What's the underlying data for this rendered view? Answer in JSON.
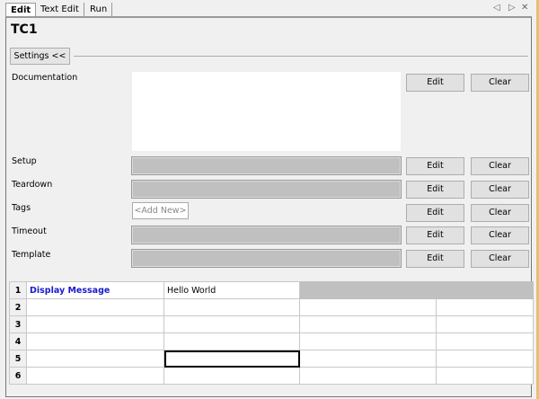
{
  "tabs": [
    {
      "label": "Edit",
      "active": true
    },
    {
      "label": "Text Edit"
    },
    {
      "label": "Run"
    }
  ],
  "nav": {
    "prev": "◁",
    "next": "▷",
    "close": "✕"
  },
  "title": "TC1",
  "settings_label": "Settings <<",
  "fields": {
    "documentation": "Documentation",
    "setup": "Setup",
    "teardown": "Teardown",
    "tags": "Tags",
    "timeout": "Timeout",
    "template": "Template"
  },
  "buttons": {
    "edit": "Edit",
    "clear": "Clear"
  },
  "tags_placeholder": "<Add New>",
  "grid": {
    "rows": [
      {
        "num": "1",
        "cells": [
          "Display Message",
          "Hello World",
          "",
          ""
        ]
      },
      {
        "num": "2",
        "cells": [
          "",
          "",
          "",
          ""
        ]
      },
      {
        "num": "3",
        "cells": [
          "",
          "",
          "",
          ""
        ]
      },
      {
        "num": "4",
        "cells": [
          "",
          "",
          "",
          ""
        ]
      },
      {
        "num": "5",
        "cells": [
          "",
          "",
          "",
          ""
        ]
      },
      {
        "num": "6",
        "cells": [
          "",
          "",
          "",
          ""
        ]
      }
    ]
  }
}
